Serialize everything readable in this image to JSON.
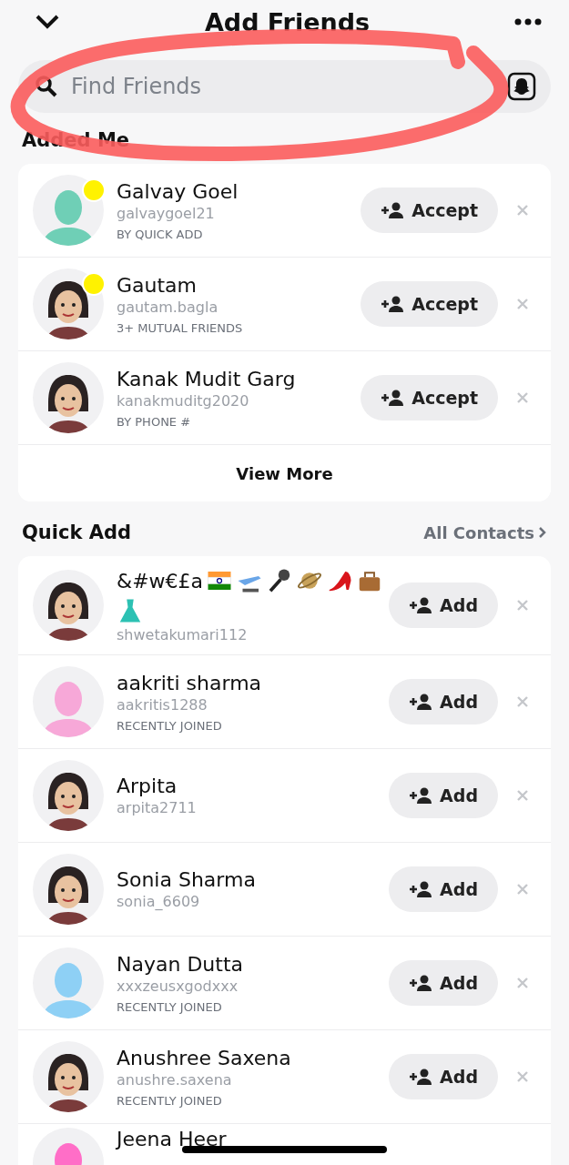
{
  "header": {
    "title": "Add Friends"
  },
  "search": {
    "placeholder": "Find Friends"
  },
  "added_me": {
    "title": "Added Me",
    "more": "View More",
    "items": [
      {
        "name": "Galvay Goel",
        "username": "galvaygoel21",
        "reason": "BY QUICK ADD",
        "action": "Accept",
        "new": true,
        "kind": "silhouette",
        "color": "#6fcfb6"
      },
      {
        "name": "Gautam",
        "username": "gautam.bagla",
        "reason": "3+ MUTUAL FRIENDS",
        "action": "Accept",
        "new": true,
        "kind": "cartoon",
        "color": "#e8c2a0"
      },
      {
        "name": "Kanak Mudit Garg",
        "username": "kanakmuditg2020",
        "reason": "BY PHONE #",
        "action": "Accept",
        "new": false,
        "kind": "cartoon",
        "color": "#e8c2a0"
      }
    ]
  },
  "quick_add": {
    "title": "Quick Add",
    "link": "All Contacts",
    "items": [
      {
        "name": "&#w€£a",
        "emoji": [
          {
            "kind": "flag"
          },
          {
            "kind": "airplane"
          },
          {
            "kind": "microphone"
          },
          {
            "kind": "planet"
          },
          {
            "kind": "heel"
          },
          {
            "kind": "handbag"
          },
          {
            "kind": "dress"
          }
        ],
        "username": "shwetakumari112",
        "action": "Add",
        "kind": "cartoon",
        "color": "#e8c2a0"
      },
      {
        "name": "aakriti sharma",
        "username": "aakritis1288",
        "reason": "RECENTLY JOINED",
        "action": "Add",
        "kind": "silhouette",
        "color": "#f7a8d8"
      },
      {
        "name": "Arpita",
        "username": "arpita2711",
        "action": "Add",
        "kind": "cartoon",
        "color": "#e8c2a0"
      },
      {
        "name": "Sonia Sharma",
        "username": "sonia_6609",
        "action": "Add",
        "kind": "cartoon",
        "color": "#e8c2a0"
      },
      {
        "name": "Nayan Dutta",
        "username": "xxxzeusxgodxxx",
        "reason": "RECENTLY JOINED",
        "action": "Add",
        "kind": "silhouette",
        "color": "#8ed0f5"
      },
      {
        "name": "Anushree Saxena",
        "username": "anushre.saxena",
        "reason": "RECENTLY JOINED",
        "action": "Add",
        "kind": "cartoon",
        "color": "#e8c2a0"
      },
      {
        "name": "Jeena Heer",
        "kind": "silhouette",
        "color": "#ff6ec7"
      }
    ]
  }
}
